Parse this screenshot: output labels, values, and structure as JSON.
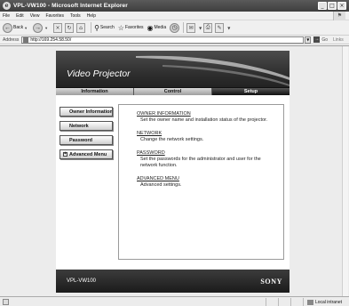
{
  "window": {
    "title": "VPL-VW100 - Microsoft Internet Explorer",
    "minimize": "_",
    "maximize": "□",
    "close": "×"
  },
  "menubar": {
    "items": [
      "File",
      "Edit",
      "View",
      "Favorites",
      "Tools",
      "Help"
    ]
  },
  "toolbar": {
    "back_label": "Back",
    "search_label": "Search",
    "favorites_label": "Favorites",
    "media_label": "Media"
  },
  "address": {
    "label": "Address",
    "url": "http://169.254.58.50/",
    "go_label": "Go",
    "links_label": "Links"
  },
  "page": {
    "banner_title": "Video Projector",
    "tabs": [
      {
        "label": "Information"
      },
      {
        "label": "Control"
      },
      {
        "label": "Setup"
      }
    ],
    "active_tab": "Setup",
    "nav": {
      "owner_information": "Owner Information",
      "network": "Network",
      "password": "Password",
      "advanced_menu": "Advanced Menu",
      "advanced_toggle": "+"
    },
    "sections": [
      {
        "title": "OWNER INFORMATION",
        "desc": "Set the owner name and installation status of the projector."
      },
      {
        "title": "NETWORK",
        "desc": "Change the network settings."
      },
      {
        "title": "PASSWORD",
        "desc": "Set the passwords for the administrator and user for the network function."
      },
      {
        "title": "ADVANCED MENU",
        "desc": "Advanced settings."
      }
    ],
    "footer": {
      "model": "VPL-VW100",
      "brand": "SONY"
    }
  },
  "statusbar": {
    "zone": "Local intranet"
  },
  "colors": {
    "banner_dark": "#1b1b1b",
    "tab_active": "#111111",
    "titlebar": "#4a4a4a"
  }
}
